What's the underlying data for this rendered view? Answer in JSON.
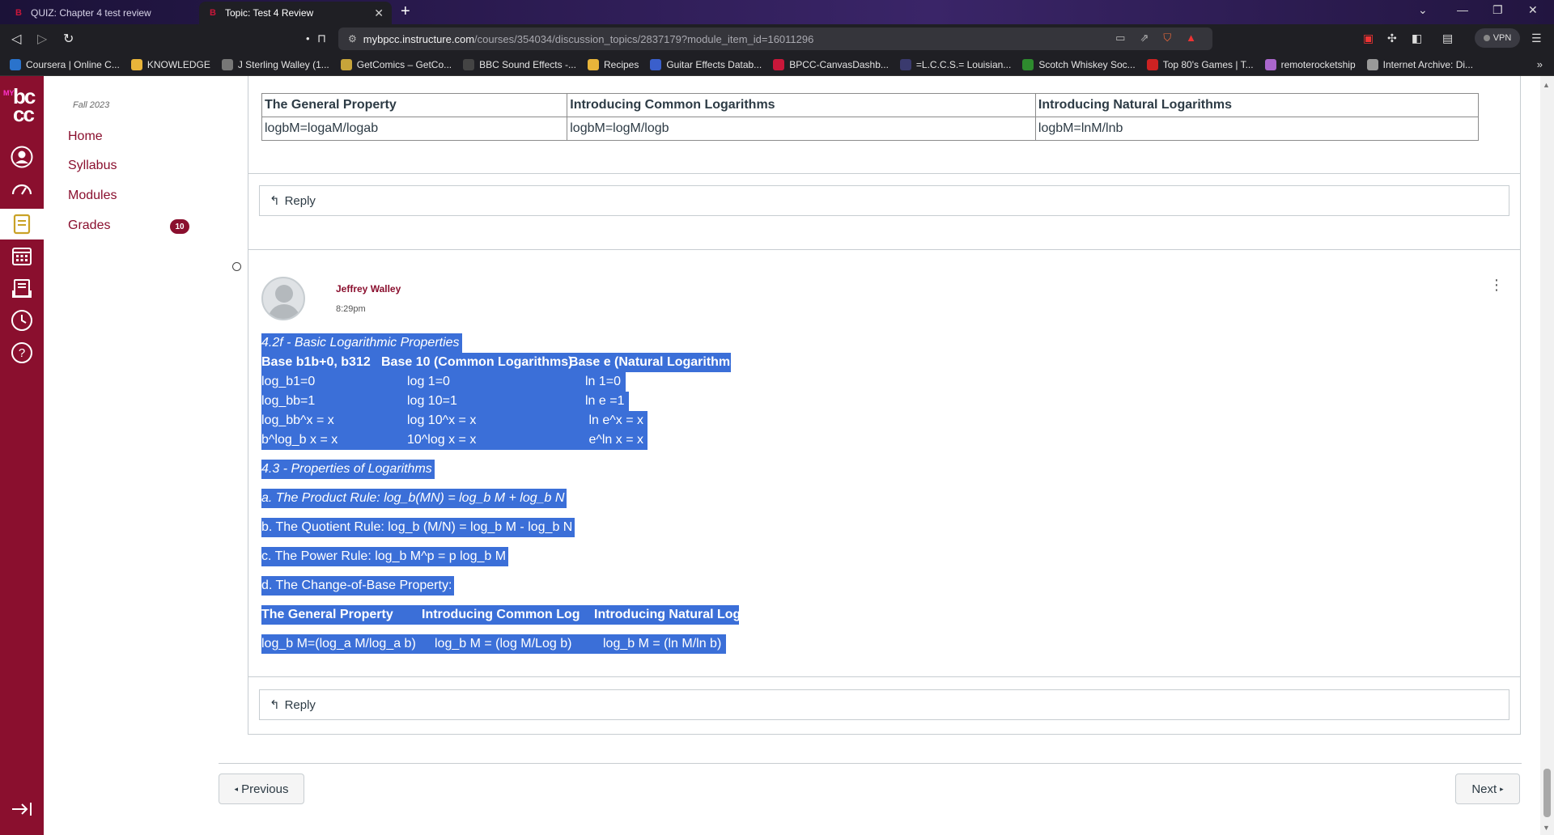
{
  "browser": {
    "tabs": [
      {
        "title": "QUIZ: Chapter 4 test review",
        "favicon": "bpcc-icon",
        "active": false
      },
      {
        "title": "Topic: Test 4 Review",
        "favicon": "bpcc-icon",
        "active": true
      }
    ],
    "url_domain": "mybpcc.instructure.com",
    "url_path": "/courses/354034/discussion_topics/2837179?module_item_id=16011296",
    "vpn_label": "VPN",
    "bookmarks": [
      {
        "label": "Coursera | Online C...",
        "color": "#2a73cc"
      },
      {
        "label": "KNOWLEDGE",
        "color": "#e8b43a"
      },
      {
        "label": "J Sterling Walley (1...",
        "color": "#777777"
      },
      {
        "label": "GetComics – GetCo...",
        "color": "#c7a43a"
      },
      {
        "label": "BBC Sound Effects -...",
        "color": "#444444"
      },
      {
        "label": "Recipes",
        "color": "#e8b43a"
      },
      {
        "label": "Guitar Effects Datab...",
        "color": "#3a5fcc"
      },
      {
        "label": "BPCC-CanvasDashb...",
        "color": "#c9173a"
      },
      {
        "label": "=L.C.C.S.= Louisian...",
        "color": "#3a3a6e"
      },
      {
        "label": "Scotch Whiskey Soc...",
        "color": "#2e8b2e"
      },
      {
        "label": "Top 80's Games | T...",
        "color": "#cc2222"
      },
      {
        "label": "remoterocketship",
        "color": "#aa66cc"
      },
      {
        "label": "Internet Archive: Di...",
        "color": "#999999"
      }
    ]
  },
  "course_nav": {
    "term": "Fall 2023",
    "items": [
      {
        "label": "Home"
      },
      {
        "label": "Syllabus"
      },
      {
        "label": "Modules"
      },
      {
        "label": "Grades",
        "badge": "10"
      }
    ]
  },
  "global_nav": {
    "icons": [
      "account-icon",
      "dashboard-icon",
      "courses-icon",
      "calendar-icon",
      "inbox-icon",
      "history-icon",
      "help-icon"
    ]
  },
  "prev_table": {
    "headers": [
      "The General Property",
      "Introducing Common Logarithms",
      "Introducing Natural Logarithms"
    ],
    "row": [
      "logbM=logaM/logab",
      "logbM=logM/logb",
      "logbM=lnM/lnb"
    ]
  },
  "reply_label": "Reply",
  "post": {
    "author": "Jeffrey Walley",
    "time": "8:29pm",
    "section1_title": "4.2f - Basic Logarithmic Properties",
    "section1_headers": [
      "Base b1b+0, b312",
      "Base 10 (Common Logarithms)",
      "Base e (Natural Logarithms)"
    ],
    "section1_rows": [
      [
        "log_b1=0",
        "log 1=0",
        "ln 1=0"
      ],
      [
        "log_bb=1",
        "log 10=1",
        "ln e =1"
      ],
      [
        "log_bb^x = x",
        "log 10^x = x",
        " ln e^x = x"
      ],
      [
        "b^log_b x = x",
        "10^log x = x",
        " e^ln x = x"
      ]
    ],
    "section2_title": "4.3 - Properties of Logarithms",
    "rule_a": "a. The Product Rule: log_b(MN) = log_b M + log_b N",
    "rule_b": "b. The Quotient Rule: log_b (M/N) = log_b M - log_b N",
    "rule_c": "c. The Power Rule: log_b M^p = p log_b M",
    "rule_d": "d. The Change-of-Base Property:",
    "cob_headers": [
      "The General Property",
      "Introducing Common Log",
      "Introducing Natural Logs"
    ],
    "cob_values": [
      "log_b M=(log_a M/log_a b)",
      "log_b M = (log M/Log b)",
      "log_b M = (ln M/ln b)"
    ]
  },
  "pagination": {
    "previous": "Previous",
    "next": "Next"
  },
  "colors": {
    "brand": "#8a0f2e",
    "selection": "#3b6fd8"
  }
}
